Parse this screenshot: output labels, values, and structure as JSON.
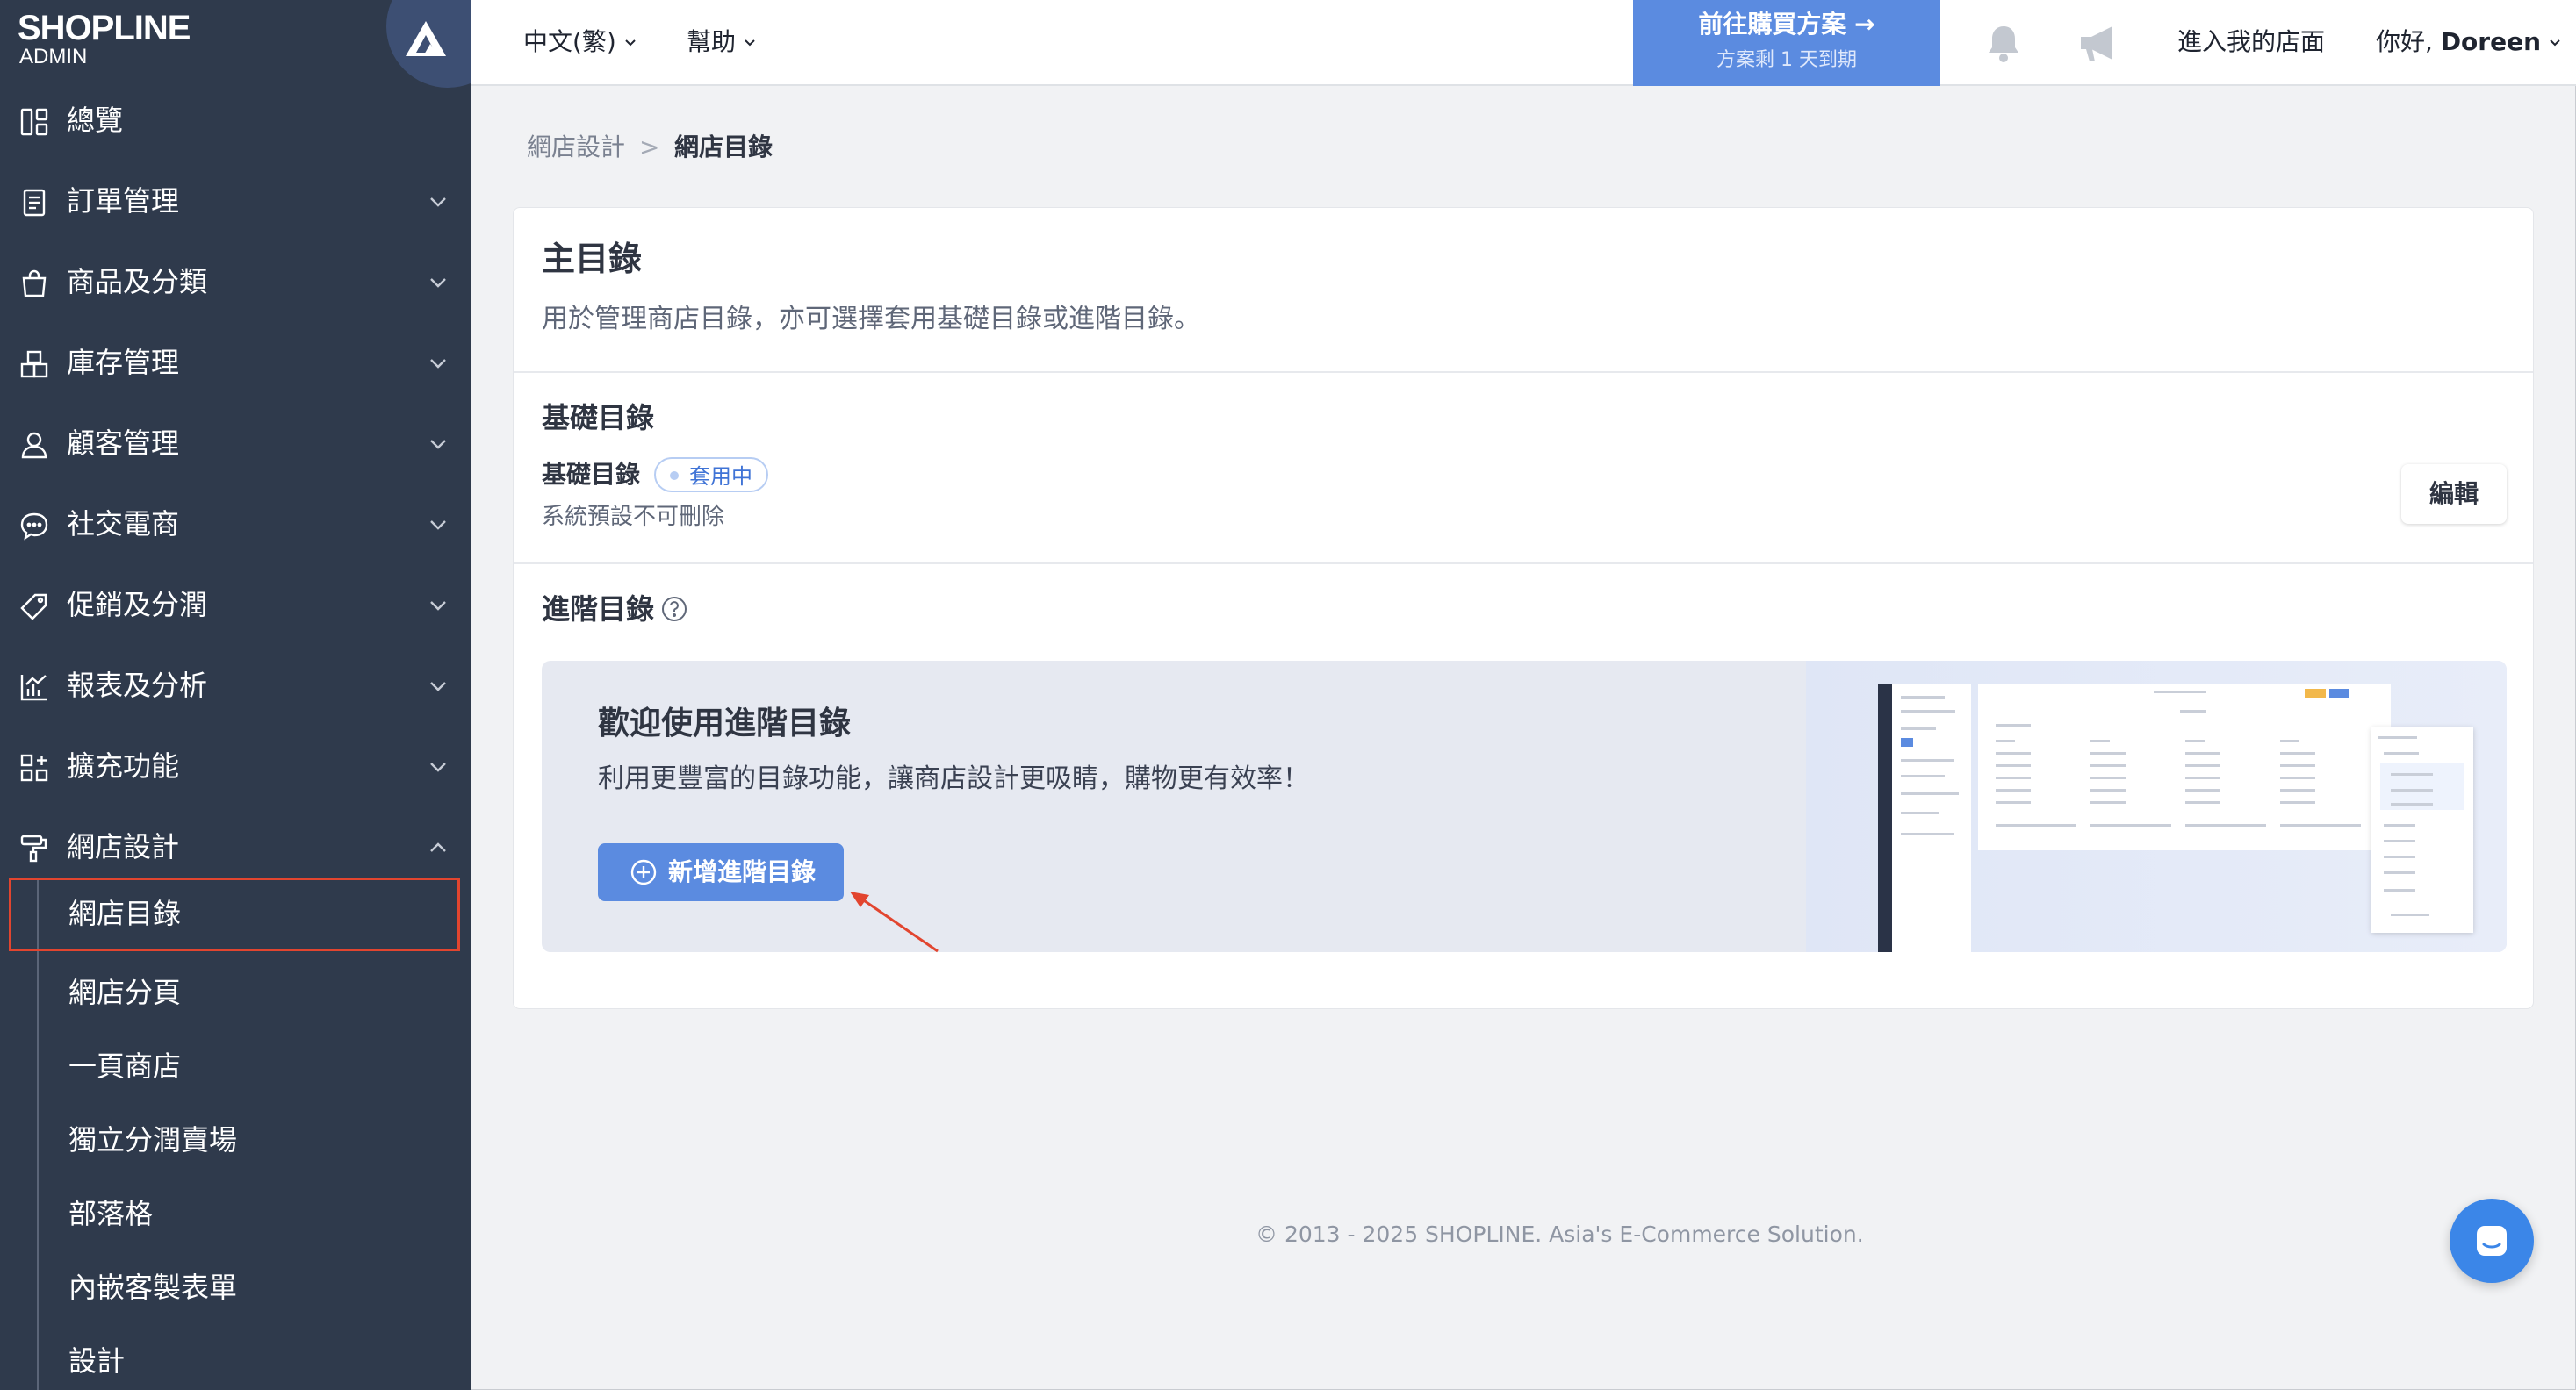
{
  "brand": {
    "name": "SHOPLINE",
    "sub": "ADMIN"
  },
  "sidebar": {
    "items": [
      {
        "label": "總覽",
        "icon": "dashboard-icon"
      },
      {
        "label": "訂單管理",
        "icon": "order-icon"
      },
      {
        "label": "商品及分類",
        "icon": "shopping-bag-icon"
      },
      {
        "label": "庫存管理",
        "icon": "inventory-icon"
      },
      {
        "label": "顧客管理",
        "icon": "customer-icon"
      },
      {
        "label": "社交電商",
        "icon": "chat-bubble-icon"
      },
      {
        "label": "促銷及分潤",
        "icon": "tag-icon"
      },
      {
        "label": "報表及分析",
        "icon": "analytics-icon"
      },
      {
        "label": "擴充功能",
        "icon": "apps-icon"
      },
      {
        "label": "網店設計",
        "icon": "paint-roller-icon"
      }
    ],
    "sub_items": [
      {
        "label": "網店目錄",
        "active": true
      },
      {
        "label": "網店分頁"
      },
      {
        "label": "一頁商店"
      },
      {
        "label": "獨立分潤賣場"
      },
      {
        "label": "部落格"
      },
      {
        "label": "內嵌客製表單"
      },
      {
        "label": "設計"
      }
    ]
  },
  "topbar": {
    "language": "中文(繁)",
    "help": "幫助",
    "plan_title": "前往購買方案 →",
    "plan_sub": "方案剩 1 天到期",
    "visit_store": "進入我的店面",
    "greeting": "你好,",
    "user_name": "Doreen"
  },
  "breadcrumb": {
    "parent": "網店設計",
    "separator": ">",
    "current": "網店目錄"
  },
  "main": {
    "title": "主目錄",
    "description": "用於管理商店目錄，亦可選擇套用基礎目錄或進階目錄。",
    "basic": {
      "heading": "基礎目錄",
      "name": "基礎目錄",
      "badge": "套用中",
      "note": "系統預設不可刪除",
      "edit_label": "編輯"
    },
    "advanced": {
      "heading": "進階目錄",
      "promo_title": "歡迎使用進階目錄",
      "promo_desc": "利用更豐富的目錄功能，讓商店設計更吸睛，購物更有效率！",
      "add_label": "新增進階目錄"
    }
  },
  "footer": "© 2013 - 2025 SHOPLINE. Asia's E-Commerce Solution.",
  "colors": {
    "sidebar": "#2f3a4c",
    "accent": "#5b8be0",
    "highlight": "#e2452f"
  }
}
